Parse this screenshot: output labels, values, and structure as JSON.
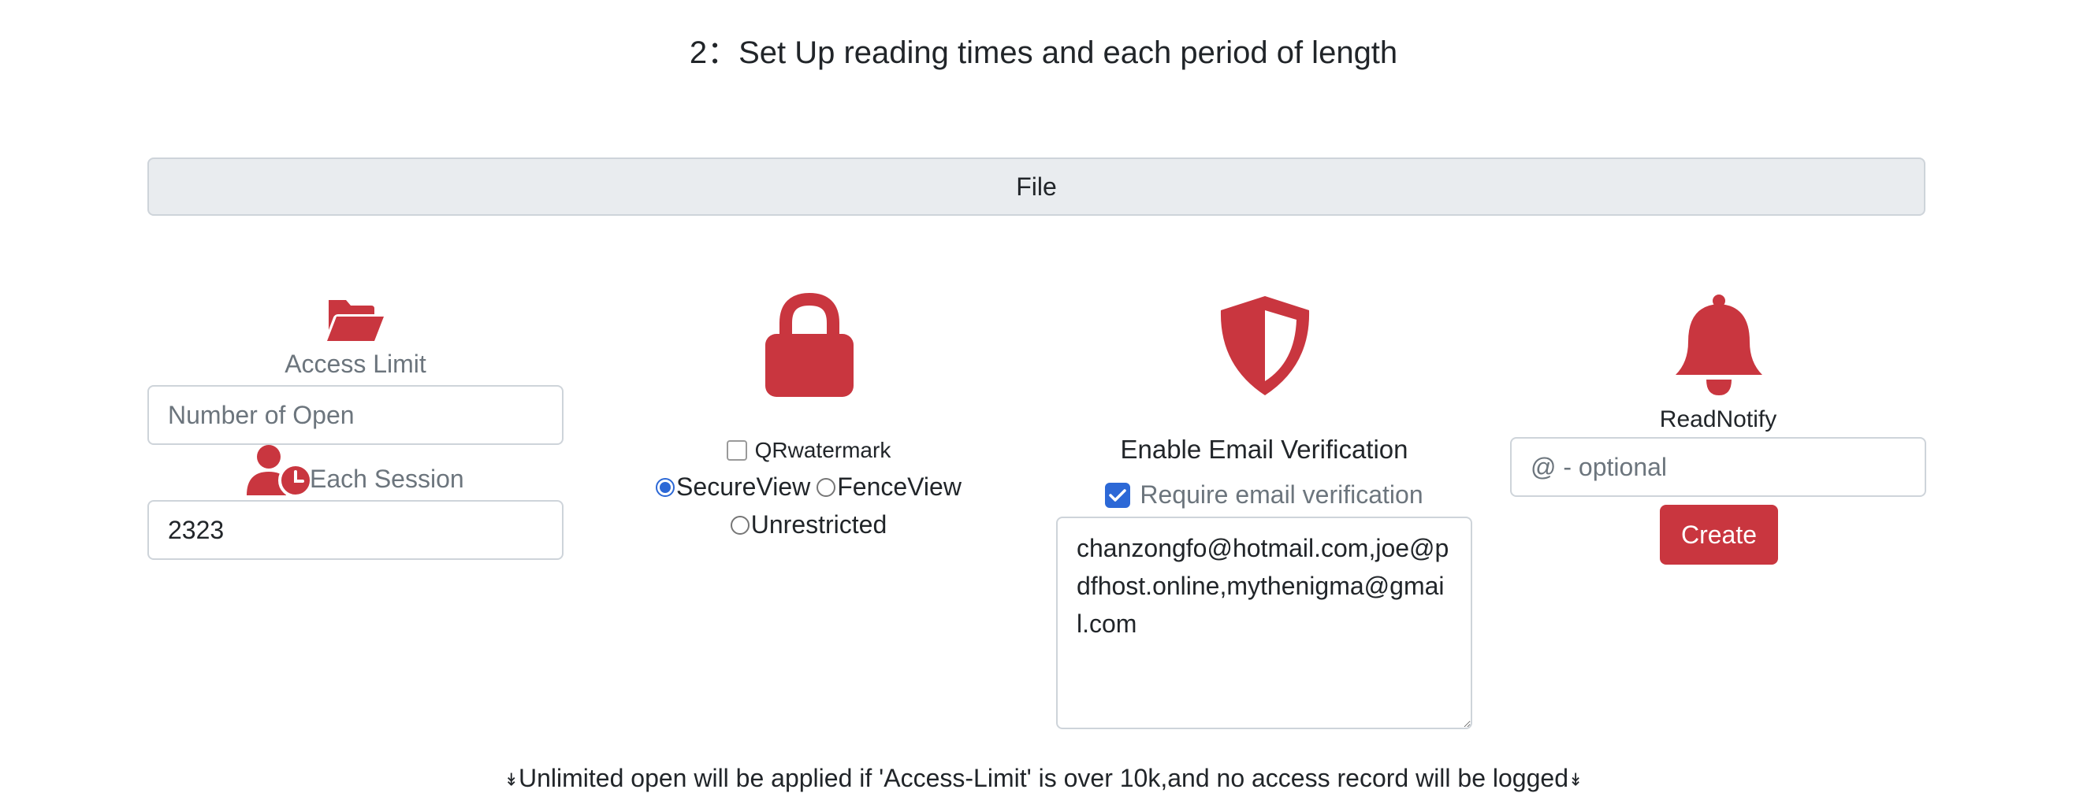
{
  "header": {
    "title": "2：Set Up reading times and each period of length"
  },
  "file_bar": {
    "label": "File"
  },
  "access_column": {
    "folder_icon": "folder-open-icon",
    "access_limit_label": "Access Limit",
    "access_limit_placeholder": "Number of Open",
    "access_limit_value": "",
    "session_icon": "user-clock-icon",
    "each_session_label": "Each Session",
    "each_session_value": "2323"
  },
  "protection_column": {
    "lock_icon": "lock-icon",
    "qr_watermark_label": "QRwatermark",
    "qr_watermark_checked": false,
    "view_options": [
      {
        "label": "SecureView",
        "checked": true
      },
      {
        "label": "FenceView",
        "checked": false
      },
      {
        "label": "Unrestricted",
        "checked": false
      }
    ]
  },
  "email_column": {
    "shield_icon": "shield-half-icon",
    "title": "Enable Email Verification",
    "require_label": "Require email verification",
    "require_checked": true,
    "emails": "chanzongfo@hotmail.com,joe@pdfhost.online,mythenigma@gmail.com"
  },
  "notify_column": {
    "bell_icon": "bell-icon",
    "label": "ReadNotify",
    "placeholder": "@ - optional",
    "value": "",
    "create_label": "Create"
  },
  "footer": {
    "note": "Unlimited open will be applied if 'Access-Limit' is over 10k,and no access record will be logged",
    "arrow_glyph": "↡"
  },
  "colors": {
    "accent_red": "#c9363f",
    "checkbox_blue": "#2c68d6",
    "muted_text": "#6c757d"
  }
}
